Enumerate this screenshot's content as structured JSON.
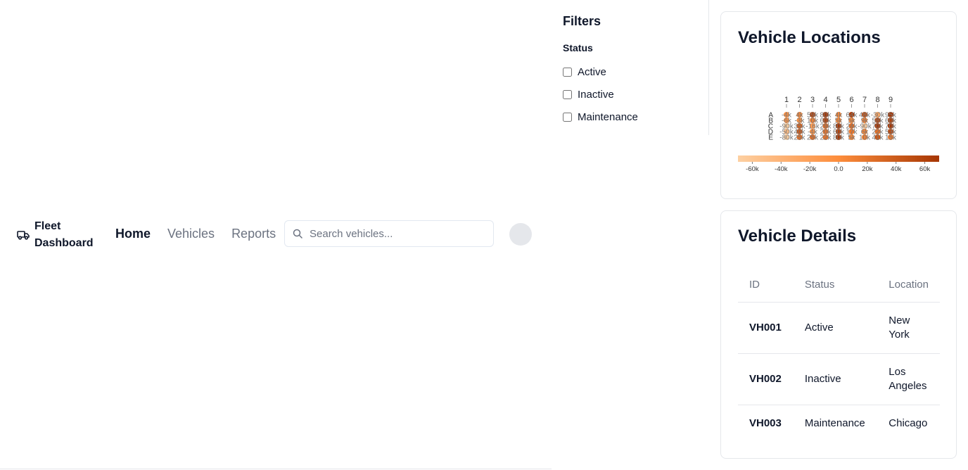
{
  "app": {
    "brand_icon": "truck-icon",
    "brand_line1": "Fleet",
    "brand_line2": "Dashboard"
  },
  "nav": {
    "items": [
      {
        "label": "Home",
        "active": true
      },
      {
        "label": "Vehicles",
        "active": false
      },
      {
        "label": "Reports",
        "active": false
      }
    ]
  },
  "search": {
    "icon": "search-icon",
    "placeholder": "Search vehicles...",
    "value": ""
  },
  "filters": {
    "title": "Filters",
    "status_heading": "Status",
    "options": [
      {
        "label": "Active",
        "checked": false
      },
      {
        "label": "Inactive",
        "checked": false
      },
      {
        "label": "Maintenance",
        "checked": false
      }
    ]
  },
  "map_card": {
    "title": "Vehicle Locations"
  },
  "vehicle_card": {
    "title": "Vehicle Details",
    "columns": [
      "ID",
      "Status",
      "Location"
    ],
    "rows": [
      {
        "id": "VH001",
        "status": "Active",
        "location": "New York"
      },
      {
        "id": "VH002",
        "status": "Inactive",
        "location": "Los Angeles"
      },
      {
        "id": "VH003",
        "status": "Maintenance",
        "location": "Chicago"
      }
    ]
  },
  "chart_data": {
    "type": "heatmap",
    "x_categories": [
      "1",
      "2",
      "3",
      "4",
      "5",
      "6",
      "7",
      "8",
      "9"
    ],
    "y_categories": [
      "A",
      "B",
      "C",
      "D",
      "E"
    ],
    "values": [
      [
        -4000,
        4000,
        59000,
        80000,
        4000,
        64000,
        48000,
        -30000,
        95000
      ],
      [
        -6000,
        -3000,
        10000,
        60000,
        5000,
        5000,
        9000,
        58000,
        60000
      ],
      [
        -90000,
        35000,
        -16000,
        29000,
        80000,
        24000,
        -90000,
        70000,
        70000
      ],
      [
        -50000,
        40000,
        -4000,
        20000,
        60000,
        17000,
        6000,
        22000,
        53000
      ],
      [
        -80000,
        25000,
        25000,
        22000,
        80000,
        5000,
        10000,
        41000,
        15000
      ]
    ],
    "colorbar": {
      "ticks": [
        "-60k",
        "-40k",
        "-20k",
        "0.0",
        "20k",
        "40k",
        "60k"
      ],
      "range": [
        -70000,
        70000
      ],
      "colors": [
        "#fdd0a2",
        "#fd8d3c",
        "#a63603"
      ]
    }
  },
  "colors": {
    "text": "#0f172a",
    "muted": "#6b7280",
    "border": "#e5e7eb"
  }
}
